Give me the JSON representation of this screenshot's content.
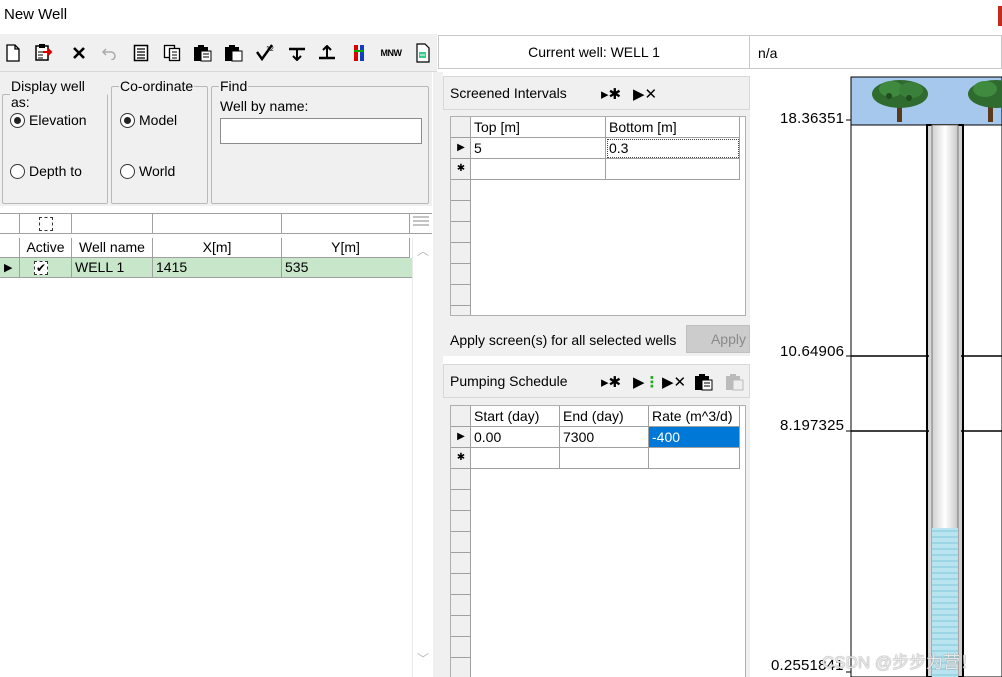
{
  "window": {
    "title": "New Well"
  },
  "toolbar": {
    "current_well": "Current well: WELL 1",
    "na_value": "n/a",
    "mnw_label": "MNW"
  },
  "options": {
    "display_legend": "Display well as:",
    "elevation_label": "Elevation",
    "depth_label": "Depth to",
    "coord_legend": "Co-ordinate",
    "model_label": "Model",
    "world_label": "World",
    "find_legend": "Find",
    "well_by_name_label": "Well by name:",
    "well_by_name_value": ""
  },
  "wells_grid": {
    "headers": [
      "Active",
      "Well name",
      "X[m]",
      "Y[m]"
    ],
    "rows": [
      {
        "active": true,
        "name": "WELL 1",
        "x": "1415",
        "y": "535"
      }
    ]
  },
  "screened": {
    "title": "Screened Intervals",
    "headers": [
      "Top [m]",
      "Bottom [m]"
    ],
    "rows": [
      {
        "top": "5",
        "bottom": "0.3"
      }
    ],
    "apply_text": "Apply screen(s) for all selected wells",
    "apply_button": "Apply"
  },
  "pumping": {
    "title": "Pumping Schedule",
    "headers": [
      "Start (day)",
      "End (day)",
      "Rate (m^3/d)"
    ],
    "rows": [
      {
        "start": "0.00",
        "end": "7300",
        "rate": "-400"
      }
    ]
  },
  "schematic": {
    "elevations": [
      "18.36351",
      "10.64906",
      "8.197325",
      "0.2551841"
    ],
    "sky_color": "#a6c8ec",
    "water_color": "#a8dce8"
  },
  "watermark": "CSDN @步步为营！"
}
